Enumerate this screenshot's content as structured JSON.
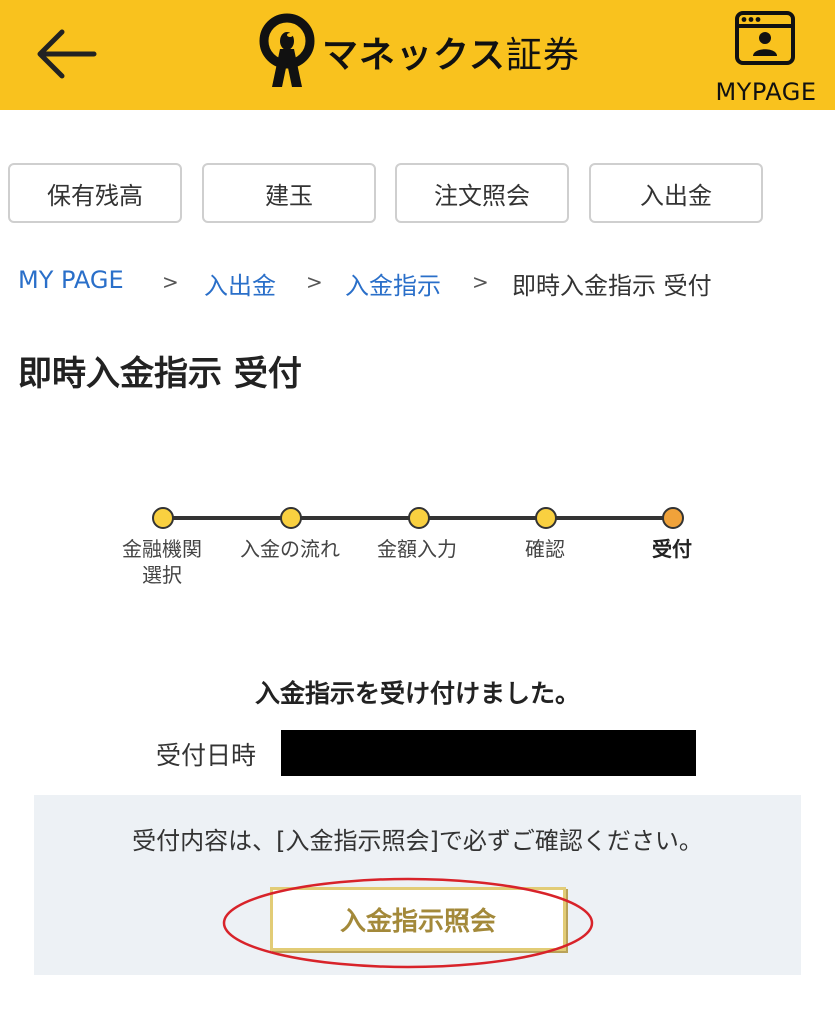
{
  "header": {
    "brand_katakana": "マネックス",
    "brand_kanji": "証券",
    "mypage_label": "MYPAGE",
    "background_color": "#F9C21E",
    "back_icon": "arrow-left-icon",
    "mypage_icon": "profile-window-icon"
  },
  "tabs": [
    {
      "label": "保有残高"
    },
    {
      "label": "建玉"
    },
    {
      "label": "注文照会"
    },
    {
      "label": "入出金"
    }
  ],
  "breadcrumb": {
    "items": [
      "MY PAGE",
      "入出金",
      "入金指示"
    ],
    "separator": ">",
    "current": "即時入金指示 受付",
    "link_color": "#2a6fc9"
  },
  "page_title": "即時入金指示 受付",
  "steps": {
    "items": [
      {
        "label_line1": "金融機関",
        "label_line2": "選択"
      },
      {
        "label_line1": "入金の流れ",
        "label_line2": ""
      },
      {
        "label_line1": "金額入力",
        "label_line2": ""
      },
      {
        "label_line1": "確認",
        "label_line2": ""
      },
      {
        "label_line1": "受付",
        "label_line2": ""
      }
    ],
    "current_index": 4
  },
  "result": {
    "message": "入金指示を受け付けました。",
    "datetime_label": "受付日時"
  },
  "notice": {
    "text": "受付内容は、[入金指示照会]で必ずご確認ください。",
    "button_label": "入金指示照会",
    "button_text_color": "#A3893A",
    "highlight_color": "#D8232A"
  }
}
